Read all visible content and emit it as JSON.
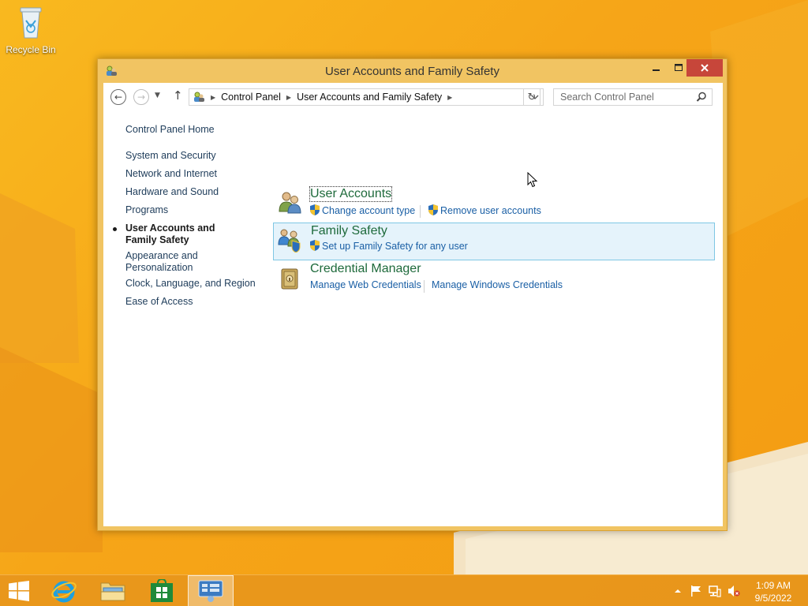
{
  "desktop": {
    "recycle_bin_label": "Recycle Bin"
  },
  "window": {
    "title": "User Accounts and Family Safety",
    "controls": {
      "minimize": "minimize-icon",
      "maximize": "maximize-icon",
      "close": "close-icon"
    }
  },
  "navbar": {
    "breadcrumbs": [
      "Control Panel",
      "User Accounts and Family Safety"
    ],
    "search_placeholder": "Search Control Panel"
  },
  "left_nav": {
    "items": [
      "Control Panel Home",
      "System and Security",
      "Network and Internet",
      "Hardware and Sound",
      "Programs",
      "User Accounts and Family Safety",
      "Appearance and Personalization",
      "Clock, Language, and Region",
      "Ease of Access"
    ],
    "current_index": 5
  },
  "categories": [
    {
      "title": "User Accounts",
      "icon": "user-accounts-icon",
      "tasks": [
        "Change account type",
        "Remove user accounts"
      ]
    },
    {
      "title": "Family Safety",
      "icon": "family-safety-icon",
      "tasks": [
        "Set up Family Safety for any user"
      ]
    },
    {
      "title": "Credential Manager",
      "icon": "credential-manager-icon",
      "tasks": [
        "Manage Web Credentials",
        "Manage Windows Credentials"
      ]
    }
  ],
  "taskbar": {
    "pinned": [
      "start-icon",
      "internet-explorer-icon",
      "file-explorer-icon",
      "store-icon",
      "control-panel-icon"
    ],
    "time": "1:09 AM",
    "date": "9/5/2022"
  },
  "colors": {
    "desktop": "#f5a81c",
    "window_frame": "#f1c462",
    "close_button": "#c7463a",
    "category_title": "#1e6a3b",
    "task_link": "#1a5fa5",
    "hover_bg": "#e5f3fb"
  }
}
